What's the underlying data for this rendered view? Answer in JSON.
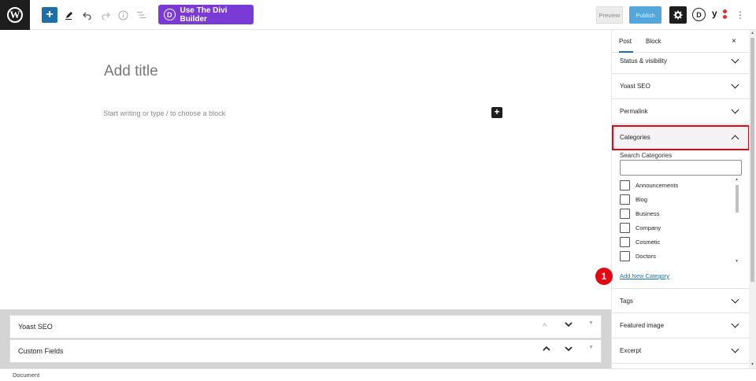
{
  "toolbar": {
    "wp_logo": "W",
    "add_block_icon": "+",
    "tools_icon": "pencil-icon",
    "undo_icon": "undo-icon",
    "redo_icon": "redo-icon",
    "info_icon": "info-icon",
    "outline_icon": "list-icon",
    "divi_button_label": "Use The Divi Builder",
    "divi_button_icon": "D",
    "preview_label": "Preview",
    "publish_label": "Publish",
    "settings_icon": "gear-icon",
    "divi_icon_label": "D",
    "yoast_icon_label": "y",
    "more_icon": "⋮"
  },
  "editor": {
    "title_placeholder": "Add title",
    "block_placeholder": "Start writing or type / to choose a block",
    "inline_add_icon": "+"
  },
  "meta_boxes": [
    {
      "label": "Yoast SEO"
    },
    {
      "label": "Custom Fields"
    }
  ],
  "status_bar": {
    "label": "Document"
  },
  "sidebar": {
    "tabs": [
      {
        "label": "Post",
        "active": true
      },
      {
        "label": "Block",
        "active": false
      }
    ],
    "close_icon": "×",
    "panels_top": [
      {
        "label": "Status & visibility"
      },
      {
        "label": "Yoast SEO"
      },
      {
        "label": "Permalink"
      }
    ],
    "categories": {
      "label": "Categories",
      "search_label": "Search Categories",
      "search_value": "",
      "items": [
        {
          "name": "Announcements",
          "checked": false
        },
        {
          "name": "Blog",
          "checked": false
        },
        {
          "name": "Business",
          "checked": false
        },
        {
          "name": "Company",
          "checked": false
        },
        {
          "name": "Cosmetic",
          "checked": false
        },
        {
          "name": "Doctors",
          "checked": false
        }
      ],
      "add_new_label": "Add New Category"
    },
    "panels_bottom": [
      {
        "label": "Tags"
      },
      {
        "label": "Featured image"
      },
      {
        "label": "Excerpt"
      }
    ]
  },
  "annotation": {
    "step_number": "1"
  },
  "colors": {
    "accent": "#1e6fa8",
    "divi_purple": "#7b39d6",
    "highlight_red": "#e30613",
    "publish_blue": "#53a7dc"
  }
}
